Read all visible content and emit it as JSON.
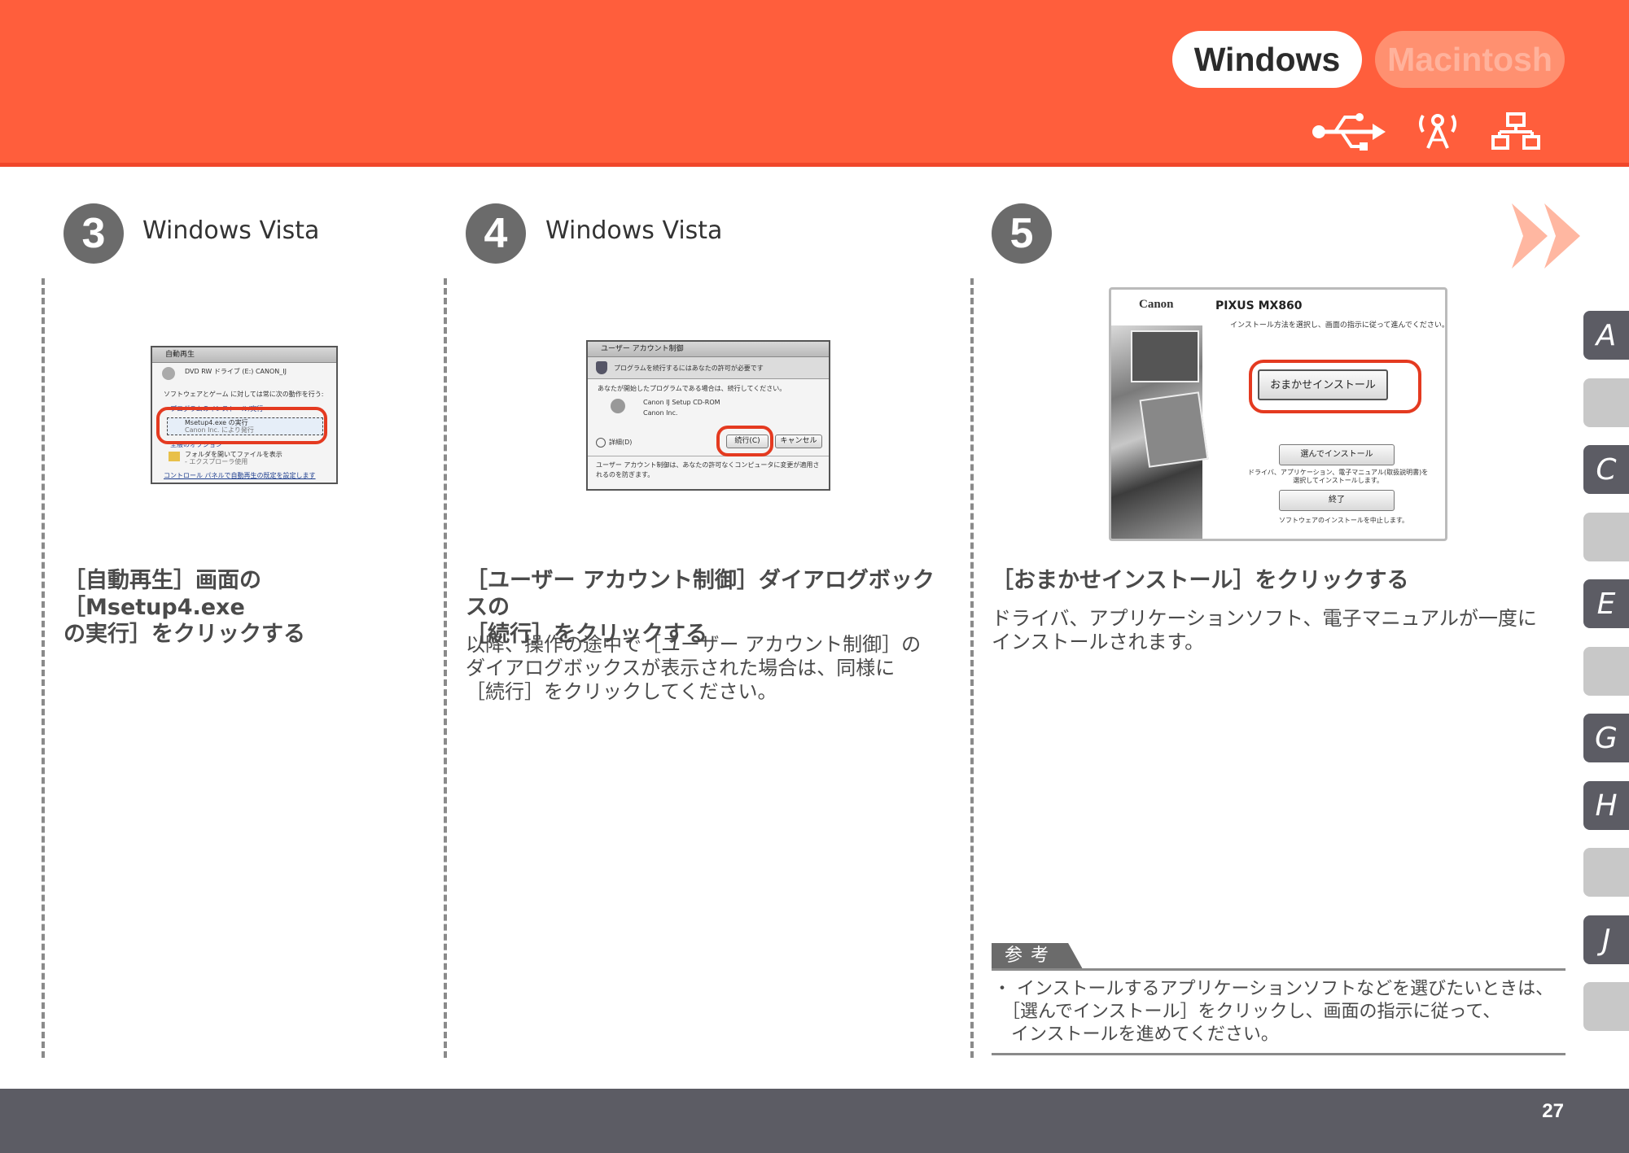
{
  "header": {
    "os_tabs": [
      {
        "label": "Windows",
        "active": true
      },
      {
        "label": "Macintosh",
        "active": false
      }
    ],
    "connection_icons": [
      "usb-icon",
      "wireless-icon",
      "network-icon"
    ]
  },
  "steps": [
    {
      "number": "3",
      "os": "Windows Vista",
      "heading": "［自動再生］画面の［Msetup4.exe\nの実行］をクリックする",
      "screenshot": {
        "title": "自動再生",
        "drive": "DVD RW ドライブ (E:) CANON_IJ",
        "checkbox": "ソフトウェアとゲーム に対しては常に次の動作を行う:",
        "section": "プログラムのインストール/実行",
        "option_name": "Msetup4.exe の実行",
        "option_publisher": "Canon Inc. により発行",
        "general_section": "全般のオプション",
        "folder_option": "フォルダを開いてファイルを表示",
        "folder_sub": "- エクスプローラ使用",
        "footer_link": "コントロール パネルで自動再生の既定を設定します"
      }
    },
    {
      "number": "4",
      "os": "Windows Vista",
      "heading": "［ユーザー アカウント制御］ダイアログボックスの\n［続行］をクリックする",
      "body": "以降、操作の途中で［ユーザー アカウント制御］の\nダイアログボックスが表示された場合は、同様に\n［続行］をクリックしてください。",
      "screenshot": {
        "title": "ユーザー アカウント制御",
        "banner": "プログラムを続行するにはあなたの許可が必要です",
        "prompt": "あなたが開始したプログラムである場合は、続行してください。",
        "program": "Canon IJ Setup CD-ROM",
        "publisher": "Canon Inc.",
        "details": "詳細(D)",
        "continue_button": "続行(C)",
        "cancel_button": "キャンセル",
        "footer": "ユーザー アカウント制御は、あなたの許可なくコンピュータに変更が適用されるのを防ぎます。"
      }
    },
    {
      "number": "5",
      "os": "",
      "heading": "［おまかせインストール］をクリックする",
      "body": "ドライバ、アプリケーションソフト、電子マニュアルが一度に\nインストールされます。",
      "screenshot": {
        "brand": "Canon",
        "model": "PIXUS MX860",
        "instruction": "インストール方法を選択し、画面の指示に従って進んでください。",
        "easy_install_button": "おまかせインストール",
        "custom_install_button": "選んでインストール",
        "custom_desc": "ドライバ、アプリケーション、電子マニュアル(取扱説明書)を\n選択してインストールします。",
        "exit_button": "終了",
        "exit_desc": "ソフトウェアのインストールを中止します。"
      }
    }
  ],
  "note": {
    "label": "参考",
    "text": "・ インストールするアプリケーションソフトなどを選びたいときは、\n　［選んでインストール］をクリックし、画面の指示に従って、\n　インストールを進めてください。"
  },
  "side_tabs": [
    "A",
    "",
    "C",
    "",
    "E",
    "",
    "G",
    "H",
    "",
    "J",
    ""
  ],
  "page_number": "27",
  "colors": {
    "header": "#ff5e3c",
    "footer": "#5c5c64",
    "step_circle": "#6b6b6b",
    "highlight_ring": "#e43a20",
    "next_arrow": "#ffb7a1"
  }
}
